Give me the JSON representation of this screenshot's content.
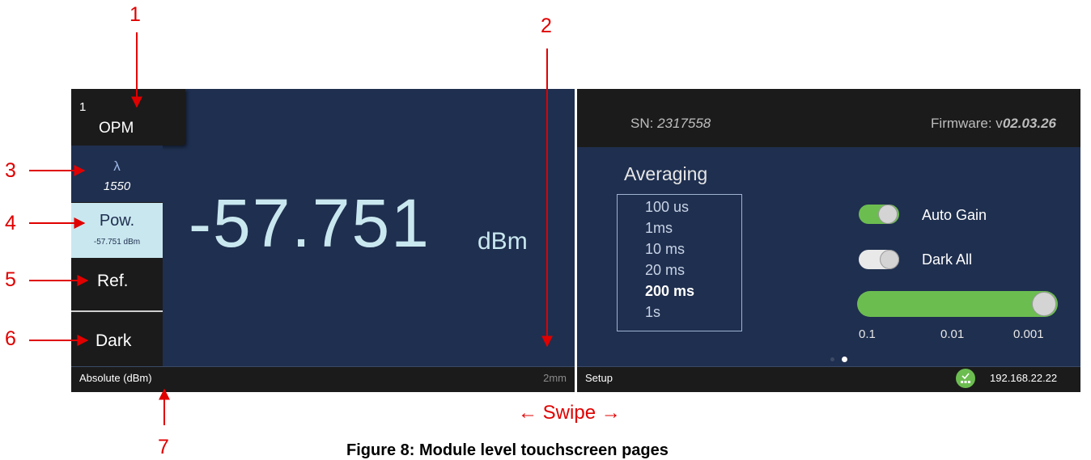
{
  "callouts": {
    "n1": "1",
    "n2": "2",
    "n3": "3",
    "n4": "4",
    "n5": "5",
    "n6": "6",
    "n7": "7"
  },
  "swipe": {
    "left": "←",
    "text": "Swipe",
    "right": "→"
  },
  "caption": "Figure 8: Module level touchscreen pages",
  "left_screen": {
    "module": {
      "index": "1",
      "label": "OPM"
    },
    "lambda": {
      "symbol": "λ",
      "value": "1550"
    },
    "pow": {
      "label": "Pow.",
      "value": "-57.751 dBm"
    },
    "ref_label": "Ref.",
    "dark_label": "Dark",
    "reading": {
      "value": "-57.751",
      "unit": "dBm"
    },
    "status": {
      "mode": "Absolute (dBm)",
      "fiber": "2mm"
    }
  },
  "right_screen": {
    "header": {
      "sn_label": "SN: ",
      "sn_value": "2317558",
      "fw_label": "Firmware: v",
      "fw_value": "02.03.26"
    },
    "averaging": {
      "title": "Averaging",
      "options": [
        "100 us",
        "1ms",
        "10 ms",
        "20 ms",
        "200 ms",
        "1s"
      ],
      "selected": "200 ms"
    },
    "auto_gain": {
      "label": "Auto Gain",
      "on": true
    },
    "dark_all": {
      "label": "Dark All",
      "on": false
    },
    "slider": {
      "labels": [
        "0.1",
        "0.01",
        "0.001"
      ],
      "value": "0.001"
    },
    "page_indicator": {
      "pages": 2,
      "current": 2
    },
    "status": {
      "left": "Setup",
      "ip": "192.168.22.22"
    }
  },
  "colors": {
    "screen_bg": "#1f2f4f",
    "panel_dark": "#1b1b1b",
    "accent_green": "#6cbd50",
    "highlight": "#c9e7ef",
    "callout_red": "#e00000"
  }
}
